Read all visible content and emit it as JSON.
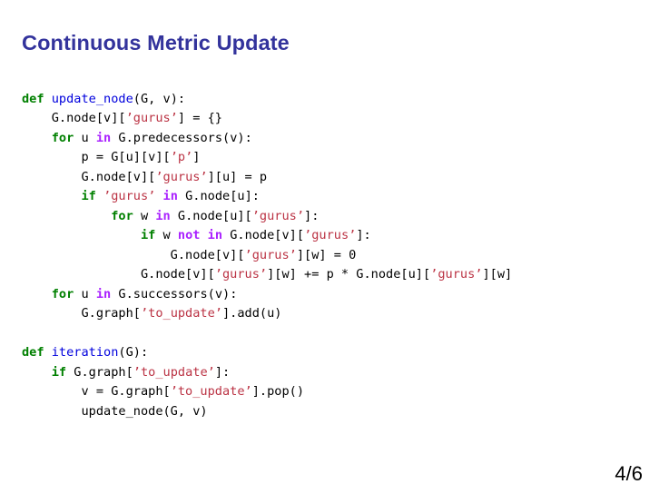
{
  "slide": {
    "title": "Continuous Metric Update",
    "title_color": "#33339c",
    "background_color": "#ffffff",
    "page_number": "4/6"
  },
  "syntax_colors": {
    "keyword": "#008000",
    "operator": "#aa22ff",
    "function_name": "#0000dd",
    "string": "#bb3344",
    "plain": "#000000"
  },
  "code": {
    "language": "python",
    "lines": [
      [
        {
          "t": "def",
          "c": "kw"
        },
        {
          "t": " ",
          "c": "pln"
        },
        {
          "t": "update_node",
          "c": "fn"
        },
        {
          "t": "(G, v):",
          "c": "pln"
        }
      ],
      [
        {
          "t": "    G.node[v][",
          "c": "pln"
        },
        {
          "t": "’gurus’",
          "c": "str"
        },
        {
          "t": "] = {}",
          "c": "pln"
        }
      ],
      [
        {
          "t": "    ",
          "c": "pln"
        },
        {
          "t": "for",
          "c": "kw"
        },
        {
          "t": " u ",
          "c": "pln"
        },
        {
          "t": "in",
          "c": "op"
        },
        {
          "t": " G.predecessors(v):",
          "c": "pln"
        }
      ],
      [
        {
          "t": "        p = G[u][v][",
          "c": "pln"
        },
        {
          "t": "’p’",
          "c": "str"
        },
        {
          "t": "]",
          "c": "pln"
        }
      ],
      [
        {
          "t": "        G.node[v][",
          "c": "pln"
        },
        {
          "t": "’gurus’",
          "c": "str"
        },
        {
          "t": "][u] = p",
          "c": "pln"
        }
      ],
      [
        {
          "t": "        ",
          "c": "pln"
        },
        {
          "t": "if",
          "c": "kw"
        },
        {
          "t": " ",
          "c": "pln"
        },
        {
          "t": "’gurus’",
          "c": "str"
        },
        {
          "t": " ",
          "c": "pln"
        },
        {
          "t": "in",
          "c": "op"
        },
        {
          "t": " G.node[u]:",
          "c": "pln"
        }
      ],
      [
        {
          "t": "            ",
          "c": "pln"
        },
        {
          "t": "for",
          "c": "kw"
        },
        {
          "t": " w ",
          "c": "pln"
        },
        {
          "t": "in",
          "c": "op"
        },
        {
          "t": " G.node[u][",
          "c": "pln"
        },
        {
          "t": "’gurus’",
          "c": "str"
        },
        {
          "t": "]:",
          "c": "pln"
        }
      ],
      [
        {
          "t": "                ",
          "c": "pln"
        },
        {
          "t": "if",
          "c": "kw"
        },
        {
          "t": " w ",
          "c": "pln"
        },
        {
          "t": "not",
          "c": "op"
        },
        {
          "t": " ",
          "c": "pln"
        },
        {
          "t": "in",
          "c": "op"
        },
        {
          "t": " G.node[v][",
          "c": "pln"
        },
        {
          "t": "’gurus’",
          "c": "str"
        },
        {
          "t": "]:",
          "c": "pln"
        }
      ],
      [
        {
          "t": "                    G.node[v][",
          "c": "pln"
        },
        {
          "t": "’gurus’",
          "c": "str"
        },
        {
          "t": "][w] = ",
          "c": "pln"
        },
        {
          "t": "0",
          "c": "num"
        }
      ],
      [
        {
          "t": "                G.node[v][",
          "c": "pln"
        },
        {
          "t": "’gurus’",
          "c": "str"
        },
        {
          "t": "][w] += p * G.node[u][",
          "c": "pln"
        },
        {
          "t": "’gurus’",
          "c": "str"
        },
        {
          "t": "][w]",
          "c": "pln"
        }
      ],
      [
        {
          "t": "    ",
          "c": "pln"
        },
        {
          "t": "for",
          "c": "kw"
        },
        {
          "t": " u ",
          "c": "pln"
        },
        {
          "t": "in",
          "c": "op"
        },
        {
          "t": " G.successors(v):",
          "c": "pln"
        }
      ],
      [
        {
          "t": "        G.graph[",
          "c": "pln"
        },
        {
          "t": "’to_update’",
          "c": "str"
        },
        {
          "t": "].add(u)",
          "c": "pln"
        }
      ],
      [],
      [
        {
          "t": "def",
          "c": "kw"
        },
        {
          "t": " ",
          "c": "pln"
        },
        {
          "t": "iteration",
          "c": "fn"
        },
        {
          "t": "(G):",
          "c": "pln"
        }
      ],
      [
        {
          "t": "    ",
          "c": "pln"
        },
        {
          "t": "if",
          "c": "kw"
        },
        {
          "t": " G.graph[",
          "c": "pln"
        },
        {
          "t": "’to_update’",
          "c": "str"
        },
        {
          "t": "]:",
          "c": "pln"
        }
      ],
      [
        {
          "t": "        v = G.graph[",
          "c": "pln"
        },
        {
          "t": "’to_update’",
          "c": "str"
        },
        {
          "t": "].pop()",
          "c": "pln"
        }
      ],
      [
        {
          "t": "        update_node(G, v)",
          "c": "pln"
        }
      ]
    ]
  }
}
